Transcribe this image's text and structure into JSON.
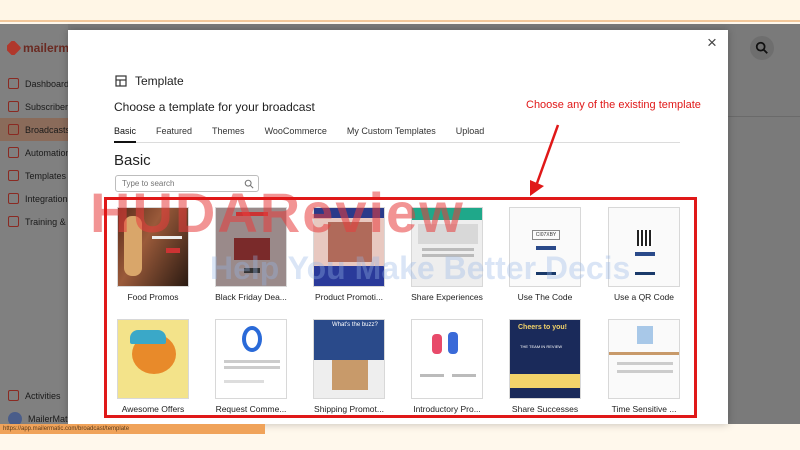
{
  "app": {
    "logo": "mailerma",
    "nav": [
      {
        "label": "Dashboard",
        "icon": "dashboard-icon",
        "active": false
      },
      {
        "label": "Subscribers",
        "icon": "subscribers-icon",
        "active": false
      },
      {
        "label": "Broadcasts",
        "icon": "broadcasts-icon",
        "active": true
      },
      {
        "label": "Automation",
        "icon": "automation-icon",
        "active": false
      },
      {
        "label": "Templates",
        "icon": "templates-icon",
        "active": false
      },
      {
        "label": "Integrations",
        "icon": "integrations-icon",
        "active": false
      },
      {
        "label": "Training & S",
        "icon": "training-icon",
        "active": false
      }
    ],
    "nav_bottom": [
      {
        "label": "Activities",
        "icon": "activities-icon"
      },
      {
        "label": "MailerMatic",
        "icon": "avatar"
      }
    ]
  },
  "modal": {
    "title": "Template",
    "subtitle": "Choose a template for your broadcast",
    "close": "×",
    "tabs": [
      "Basic",
      "Featured",
      "Themes",
      "WooCommerce",
      "My Custom Templates",
      "Upload"
    ],
    "active_tab": "Basic",
    "section": "Basic",
    "search_placeholder": "Type to search",
    "templates": [
      {
        "label": "Food Promos",
        "style": "food"
      },
      {
        "label": "Black Friday Dea...",
        "style": "blackfriday"
      },
      {
        "label": "Product Promoti...",
        "style": "product"
      },
      {
        "label": "Share Experiences",
        "style": "share"
      },
      {
        "label": "Use The Code",
        "style": "code"
      },
      {
        "label": "Use a QR Code",
        "style": "qr"
      },
      {
        "label": "Awesome Offers",
        "style": "offers"
      },
      {
        "label": "Request Comme...",
        "style": "request"
      },
      {
        "label": "Shipping Promot...",
        "style": "shipping"
      },
      {
        "label": "Introductory Pro...",
        "style": "intro"
      },
      {
        "label": "Share Successes",
        "style": "success"
      },
      {
        "label": "Time Sensitive ...",
        "style": "time"
      }
    ],
    "thumb_text": {
      "code": "CI07XBY",
      "shipping": "What's the buzz?",
      "success": "Cheers to you!",
      "success_sub": "THE TEAM IN REVIEW"
    }
  },
  "annotation": "Choose any of the existing template",
  "watermark": "HUDAReview",
  "watermark_sub": "Help You Make Better Decis",
  "status_url": "https://app.mailermatic.com/broadcast/template"
}
